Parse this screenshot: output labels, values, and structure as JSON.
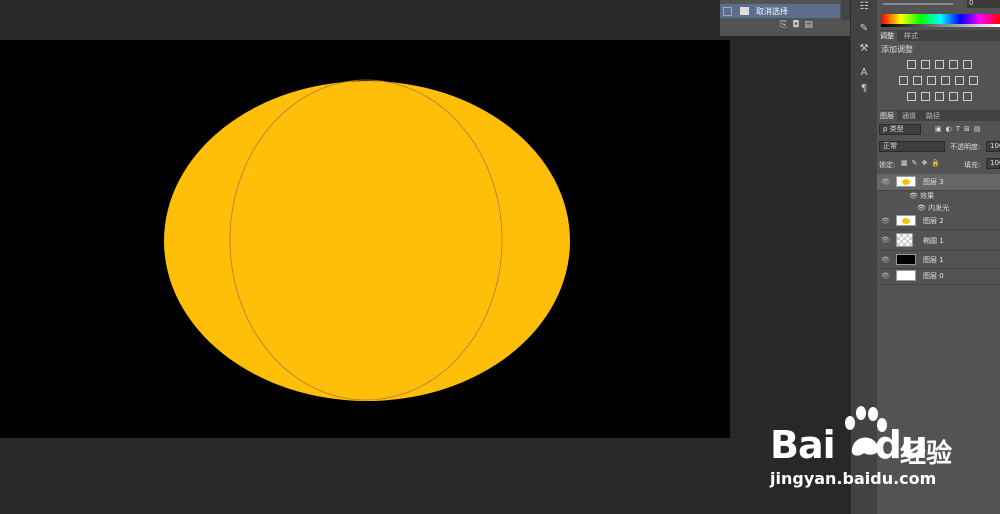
{
  "history": {
    "item_label": "取消选择"
  },
  "color_panel": {
    "value": "0"
  },
  "adjust_panel": {
    "tabs": [
      "调整",
      "样式"
    ],
    "title": "添加调整"
  },
  "layers_panel": {
    "tabs": [
      "图层",
      "通道",
      "路径"
    ],
    "filter_type": "类型",
    "blend_mode": "正常",
    "opacity_label": "不透明度:",
    "opacity_value": "100",
    "lock_label": "锁定:",
    "fill_label": "填充:",
    "fill_value": "100",
    "layers": [
      {
        "name": "图层 3",
        "thumb": "orange-ellipse",
        "selected": true
      },
      {
        "name": "图层 2",
        "thumb": "orange-ellipse",
        "selected": false
      },
      {
        "name": "椭圆 1",
        "thumb": "checker",
        "selected": false
      },
      {
        "name": "图层 1",
        "thumb": "black",
        "selected": false
      },
      {
        "name": "图层 0",
        "thumb": "white",
        "selected": false
      }
    ],
    "effects_label": "效果",
    "inner_glow_label": "内发光"
  },
  "watermark": {
    "brand": "Bai",
    "brand_tail": "du",
    "cn": "经验",
    "url": "jingyan.baidu.com"
  },
  "colors": {
    "ellipse_fill": "#FFBE08",
    "ellipse_stroke": "#B07A3A",
    "canvas_bg": "#000000"
  }
}
